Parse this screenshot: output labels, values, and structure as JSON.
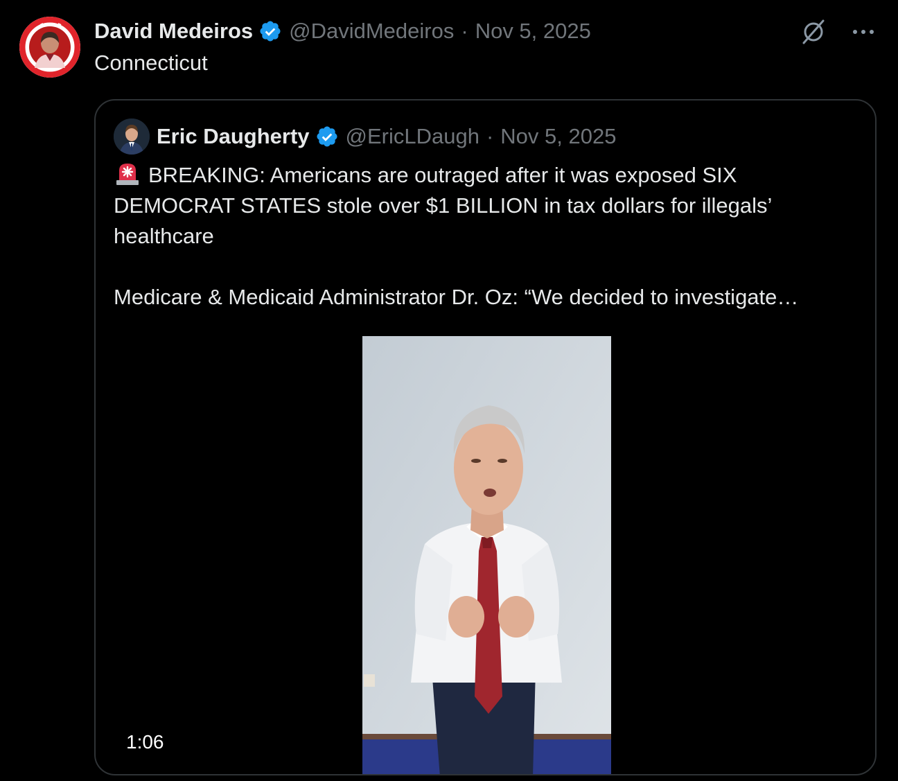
{
  "tweet": {
    "author_name": "David Medeiros",
    "author_handle": "@DavidMedeiros",
    "separator": "·",
    "date": "Nov 5, 2025",
    "text": "Connecticut",
    "avatar_icon": "avatar-logo-icon",
    "verified_icon": "verified-badge-icon",
    "grok_icon": "grok-icon",
    "more_icon": "more-icon"
  },
  "quote": {
    "author_name": "Eric Daugherty",
    "author_handle": "@EricLDaugh",
    "separator": "·",
    "date": "Nov 5, 2025",
    "emoji": "siren-emoji-icon",
    "text_p1": "BREAKING: Americans are outraged after it was exposed SIX DEMOCRAT STATES stole over $1 BILLION in tax dollars for illegals’ healthcare",
    "text_p2": "Medicare & Medicaid Administrator Dr. Oz: “We decided to investigate…",
    "video_duration": "1:06"
  },
  "colors": {
    "background": "#000000",
    "text_primary": "#e7e9ea",
    "text_secondary": "#71767b",
    "border": "#2f3336",
    "verified_blue": "#1d9bf0"
  }
}
